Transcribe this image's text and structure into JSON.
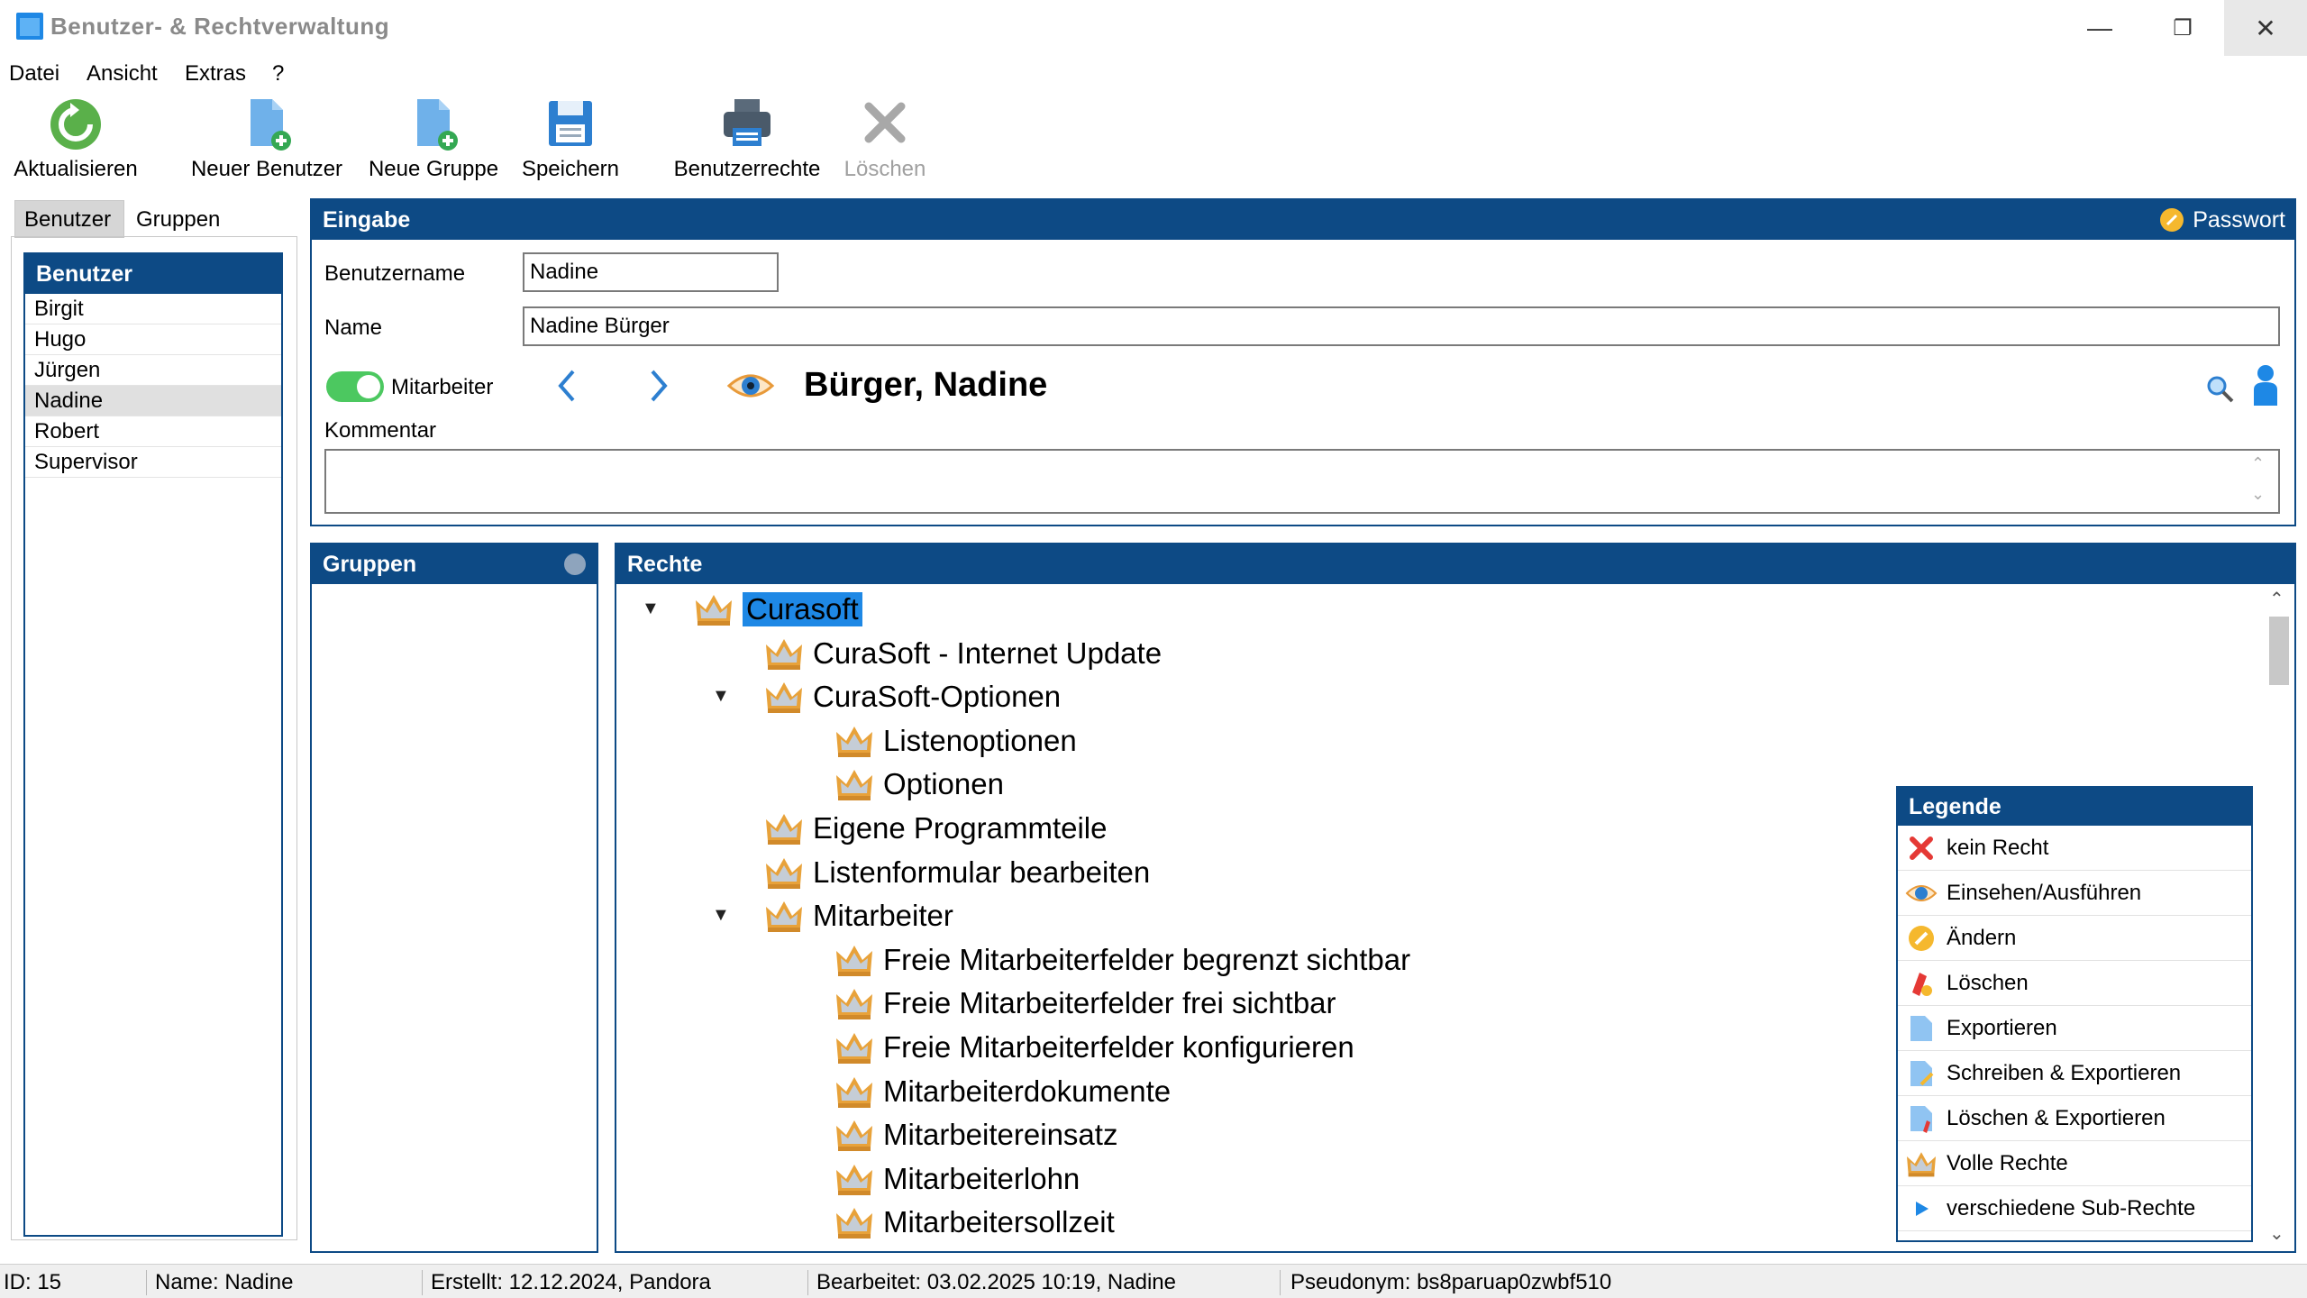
{
  "window": {
    "title": "Benutzer- & Rechtverwaltung",
    "minimize": "—",
    "restore": "❐",
    "close": "✕"
  },
  "menu": [
    "Datei",
    "Ansicht",
    "Extras",
    "?"
  ],
  "toolbar": {
    "refresh": "Aktualisieren",
    "new_user": "Neuer Benutzer",
    "new_group": "Neue Gruppe",
    "save": "Speichern",
    "user_rights": "Benutzerrechte",
    "delete": "Löschen"
  },
  "tabs": [
    "Benutzer",
    "Gruppen"
  ],
  "users_panel": {
    "title": "Benutzer",
    "items": [
      "Birgit",
      "Hugo",
      "Jürgen",
      "Nadine",
      "Robert",
      "Supervisor"
    ],
    "selected": "Nadine"
  },
  "eingabe": {
    "title": "Eingabe",
    "password_label": "Passwort",
    "username_label": "Benutzername",
    "username_value": "Nadine",
    "name_label": "Name",
    "name_value": "Nadine Bürger",
    "employee_label": "Mitarbeiter",
    "employee_on": true,
    "display_name": "Bürger, Nadine",
    "comment_label": "Kommentar",
    "comment_value": ""
  },
  "gruppen_panel": {
    "title": "Gruppen"
  },
  "rechte_panel": {
    "title": "Rechte",
    "tree": [
      {
        "label": "Curasoft",
        "level": 0,
        "expanded": true,
        "selected": true
      },
      {
        "label": "CuraSoft - Internet Update",
        "level": 1
      },
      {
        "label": "CuraSoft-Optionen",
        "level": 1,
        "expanded": true
      },
      {
        "label": "Listenoptionen",
        "level": 2
      },
      {
        "label": "Optionen",
        "level": 2
      },
      {
        "label": "Eigene Programmteile",
        "level": 1
      },
      {
        "label": "Listenformular bearbeiten",
        "level": 1
      },
      {
        "label": "Mitarbeiter",
        "level": 1,
        "expanded": true
      },
      {
        "label": "Freie Mitarbeiterfelder begrenzt sichtbar",
        "level": 2
      },
      {
        "label": "Freie Mitarbeiterfelder frei sichtbar",
        "level": 2
      },
      {
        "label": "Freie Mitarbeiterfelder konfigurieren",
        "level": 2
      },
      {
        "label": "Mitarbeiterdokumente",
        "level": 2
      },
      {
        "label": "Mitarbeitereinsatz",
        "level": 2
      },
      {
        "label": "Mitarbeiterlohn",
        "level": 2
      },
      {
        "label": "Mitarbeitersollzeit",
        "level": 2
      }
    ]
  },
  "legende": {
    "title": "Legende",
    "items": [
      {
        "icon": "red-x-icon",
        "label": "kein Recht"
      },
      {
        "icon": "eye-icon",
        "label": "Einsehen/Ausführen"
      },
      {
        "icon": "pencil-icon",
        "label": "Ändern"
      },
      {
        "icon": "eraser-icon",
        "label": "Löschen"
      },
      {
        "icon": "document-icon",
        "label": "Exportieren"
      },
      {
        "icon": "document-pencil-icon",
        "label": "Schreiben & Exportieren"
      },
      {
        "icon": "document-eraser-icon",
        "label": "Löschen & Exportieren"
      },
      {
        "icon": "crown-icon",
        "label": "Volle Rechte"
      },
      {
        "icon": "triangle-right-icon",
        "label": "verschiedene Sub-Rechte"
      }
    ]
  },
  "statusbar": {
    "id": "ID: 15",
    "name": "Name: Nadine",
    "created": "Erstellt: 12.12.2024, Pandora",
    "edited": "Bearbeitet: 03.02.2025 10:19, Nadine",
    "pseudonym": "Pseudonym: bs8paruap0zwbf510"
  },
  "colors": {
    "panel_header": "#0d4a85",
    "selection": "#1e88e5",
    "toggle_on": "#4cc860",
    "crown": "#e8a23a"
  }
}
